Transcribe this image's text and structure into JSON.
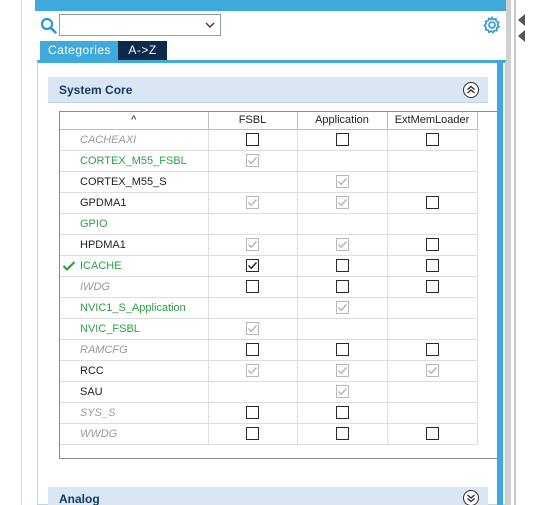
{
  "search": {
    "value": "",
    "placeholder": ""
  },
  "tabs": [
    {
      "label": "Categories",
      "active": true
    },
    {
      "label": "A->Z",
      "active": false
    }
  ],
  "section": {
    "title": "System Core",
    "analog_title": "Analog"
  },
  "grid": {
    "sort_indicator": "^",
    "columns": [
      "FSBL",
      "Application",
      "ExtMemLoader"
    ],
    "rows": [
      {
        "name": "CACHEAXI",
        "style": "grey",
        "checked_mark": false,
        "cells": [
          "empty",
          "empty",
          "empty"
        ]
      },
      {
        "name": "CORTEX_M55_FSBL",
        "style": "green",
        "checked_mark": false,
        "cells": [
          "checked-disabled",
          "none",
          "none"
        ]
      },
      {
        "name": "CORTEX_M55_S",
        "style": "black",
        "checked_mark": false,
        "cells": [
          "none",
          "checked-disabled",
          "none"
        ]
      },
      {
        "name": "GPDMA1",
        "style": "black",
        "checked_mark": false,
        "cells": [
          "checked-disabled",
          "checked-disabled",
          "empty"
        ]
      },
      {
        "name": "GPIO",
        "style": "green",
        "checked_mark": false,
        "cells": [
          "none",
          "none",
          "none"
        ]
      },
      {
        "name": "HPDMA1",
        "style": "black",
        "checked_mark": false,
        "cells": [
          "checked-disabled",
          "checked-disabled",
          "empty"
        ]
      },
      {
        "name": "ICACHE",
        "style": "green",
        "checked_mark": true,
        "cells": [
          "checked",
          "empty",
          "empty"
        ]
      },
      {
        "name": "IWDG",
        "style": "grey",
        "checked_mark": false,
        "cells": [
          "empty",
          "empty",
          "empty"
        ]
      },
      {
        "name": "NVIC1_S_Application",
        "style": "green",
        "checked_mark": false,
        "cells": [
          "none",
          "checked-disabled",
          "none"
        ]
      },
      {
        "name": "NVIC_FSBL",
        "style": "green",
        "checked_mark": false,
        "cells": [
          "checked-disabled",
          "none",
          "none"
        ]
      },
      {
        "name": "RAMCFG",
        "style": "grey",
        "checked_mark": false,
        "cells": [
          "empty",
          "empty",
          "empty"
        ]
      },
      {
        "name": "RCC",
        "style": "black",
        "checked_mark": false,
        "cells": [
          "checked-disabled",
          "checked-disabled",
          "checked-disabled"
        ]
      },
      {
        "name": "SAU",
        "style": "black",
        "checked_mark": false,
        "cells": [
          "none",
          "checked-disabled",
          "none"
        ]
      },
      {
        "name": "SYS_S",
        "style": "grey",
        "checked_mark": false,
        "cells": [
          "empty",
          "empty",
          "none"
        ]
      },
      {
        "name": "WWDG",
        "style": "grey",
        "checked_mark": false,
        "cells": [
          "empty",
          "empty",
          "empty"
        ]
      }
    ]
  },
  "colors": {
    "accent": "#3fa9dc",
    "tab_dark": "#0c2b4c",
    "green": "#2ea043",
    "section_bg": "#dbe6f4"
  },
  "icons": {
    "search": "search-icon",
    "gear": "gear-icon",
    "collapse": "chevron-double-up-icon",
    "expand": "chevron-double-down-icon"
  }
}
